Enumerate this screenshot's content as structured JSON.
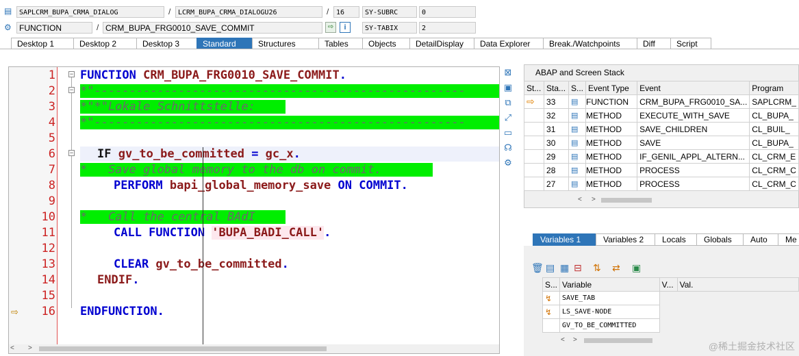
{
  "header": {
    "program": "SAPLCRM_BUPA_CRMA_DIALOG",
    "include": "LCRM_BUPA_CRMA_DIALOGU26",
    "line": "16",
    "sy_subrc_label": "SY-SUBRC",
    "sy_subrc_value": "0",
    "type": "FUNCTION",
    "name": "CRM_BUPA_FRG0010_SAVE_COMMIT",
    "sy_tabix_label": "SY-TABIX",
    "sy_tabix_value": "2",
    "sep": "/"
  },
  "tabs": [
    "Desktop 1",
    "Desktop 2",
    "Desktop 3",
    "Standard",
    "Structures",
    "Tables",
    "Objects",
    "DetailDisplay",
    "Data Explorer",
    "Break./Watchpoints",
    "Diff",
    "Script"
  ],
  "editor": {
    "line_numbers": [
      "1",
      "2",
      "3",
      "4",
      "5",
      "6",
      "7",
      "8",
      "9",
      "10",
      "11",
      "12",
      "13",
      "14",
      "15",
      "16"
    ],
    "l1_kw": "FUNCTION ",
    "l1_id": "CRM_BUPA_FRG0010_SAVE_COMMIT",
    "l1_end": ".",
    "l2": "*\"-----------------------------------------------------",
    "l3": "*\"*\"Lokale Schnittstelle:",
    "l4": "*\"-----------------------------------------------------",
    "l6_kw": "IF ",
    "l6_a": "gv_to_be_committed",
    "l6_op": " = ",
    "l6_b": "gc_x",
    "l6_end": ".",
    "l7": "*   Save global memory to the db on commit.",
    "l8_kw1": "PERFORM ",
    "l8_id": "bapi_global_memory_save",
    "l8_kw2": " ON COMMIT",
    "l8_end": ".",
    "l10": "*   Call the central BAdI",
    "l11_kw": "CALL FUNCTION ",
    "l11_str": "'BUPA_BADI_CALL'",
    "l11_end": ".",
    "l13_kw": "CLEAR ",
    "l13_id": "gv_to_be_committed",
    "l13_end": ".",
    "l14_kw": "ENDIF",
    "l14_end": ".",
    "l16_kw": "ENDFUNCTION",
    "l16_end": "."
  },
  "stack": {
    "title": "ABAP and Screen Stack",
    "columns": [
      "St...",
      "Sta...",
      "S...",
      "Event Type",
      "Event",
      "Program"
    ],
    "rows": [
      {
        "level": "33",
        "type": "FUNCTION",
        "event": "CRM_BUPA_FRG0010_SA...",
        "program": "SAPLCRM_"
      },
      {
        "level": "32",
        "type": "METHOD",
        "event": "EXECUTE_WITH_SAVE",
        "program": "CL_BUPA_"
      },
      {
        "level": "31",
        "type": "METHOD",
        "event": "SAVE_CHILDREN",
        "program": "CL_BUIL_"
      },
      {
        "level": "30",
        "type": "METHOD",
        "event": "SAVE",
        "program": "CL_BUPA_"
      },
      {
        "level": "29",
        "type": "METHOD",
        "event": "IF_GENIL_APPL_ALTERN...",
        "program": "CL_CRM_E"
      },
      {
        "level": "28",
        "type": "METHOD",
        "event": "PROCESS",
        "program": "CL_CRM_C"
      },
      {
        "level": "27",
        "type": "METHOD",
        "event": "PROCESS",
        "program": "CL_CRM_C"
      }
    ]
  },
  "variables": {
    "tabs": [
      "Variables 1",
      "Variables 2",
      "Locals",
      "Globals",
      "Auto",
      "Me"
    ],
    "columns": [
      "S...",
      "Variable",
      "V...",
      "Val."
    ],
    "rows": [
      {
        "name": "SAVE_TAB"
      },
      {
        "name": "LS_SAVE-NODE"
      },
      {
        "name": "GV_TO_BE_COMMITTED"
      }
    ]
  },
  "watermark": "@稀土掘金技术社区",
  "colors": {
    "accent": "#2e75b8",
    "comment_bg": "#00ee00",
    "keyword": "#0000d0",
    "identifier": "#8b1a1a"
  }
}
